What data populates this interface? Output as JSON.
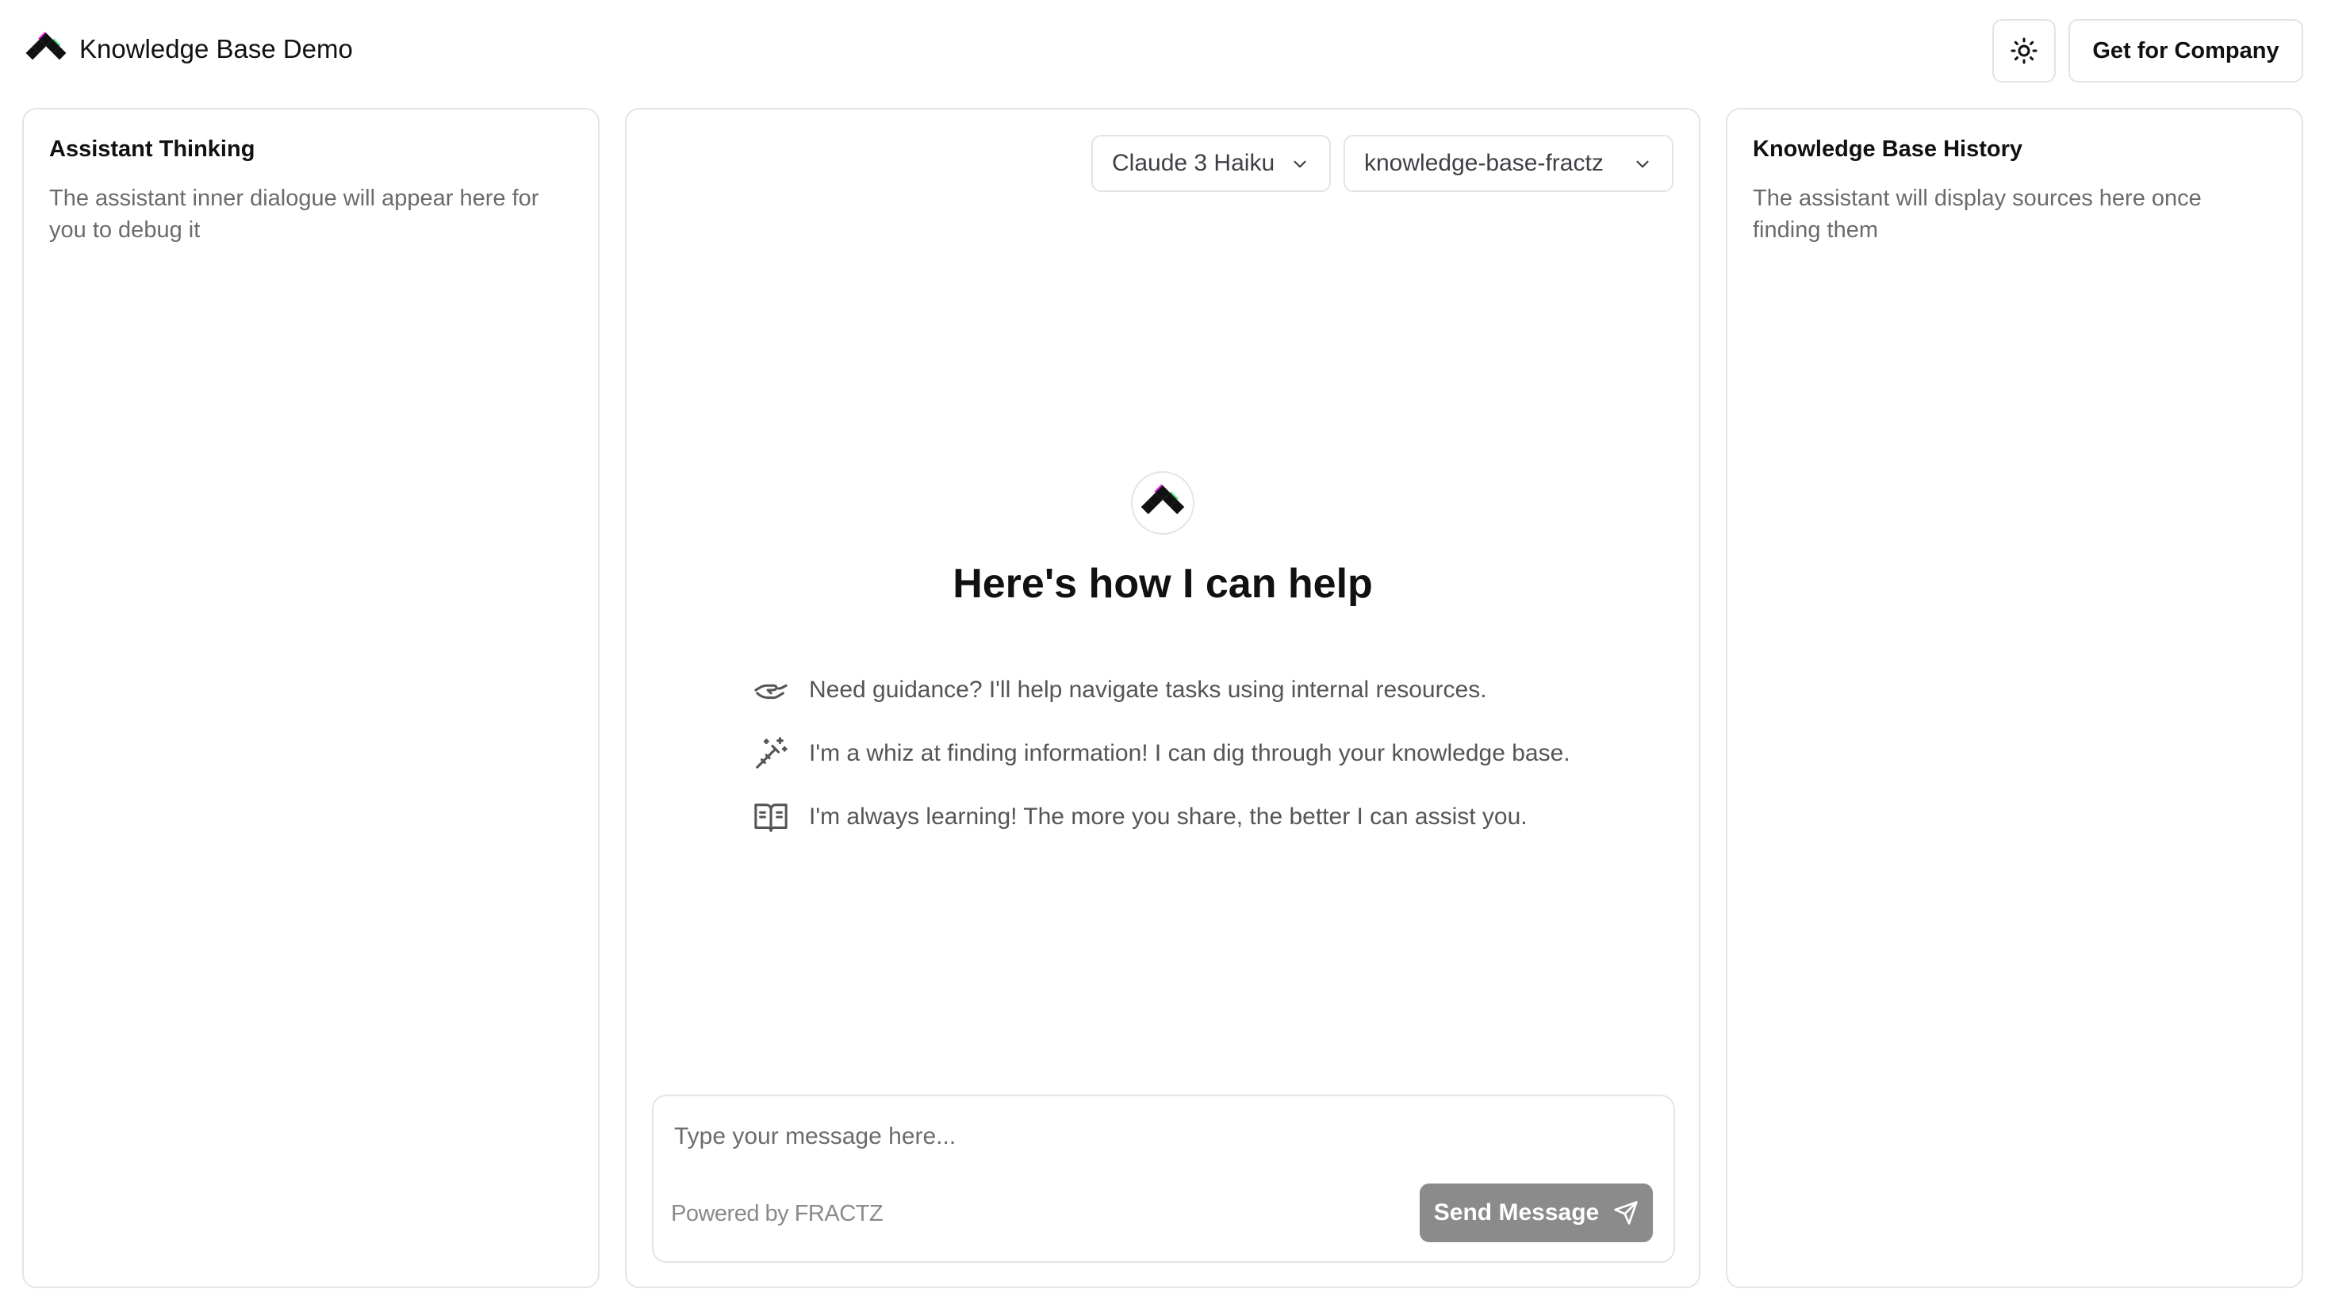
{
  "header": {
    "app_title": "Knowledge Base Demo",
    "logo_icon": "fractz-logo-icon",
    "theme_toggle_icon": "sun-icon",
    "company_button_label": "Get for Company"
  },
  "left_panel": {
    "title": "Assistant Thinking",
    "description": "The assistant inner dialogue will appear here for you to debug it"
  },
  "center_panel": {
    "model_select": {
      "selected": "Claude 3 Haiku",
      "icon": "chevron-down-icon"
    },
    "kb_select": {
      "selected": "knowledge-base-fractz",
      "icon": "chevron-down-icon"
    },
    "hero_title": "Here's how I can help",
    "features": [
      {
        "icon": "handshake-icon",
        "text": "Need guidance? I'll help navigate tasks using internal resources."
      },
      {
        "icon": "magic-wand-icon",
        "text": "I'm a whiz at finding information! I can dig through your knowledge base."
      },
      {
        "icon": "open-book-icon",
        "text": "I'm always learning! The more you share, the better I can assist you."
      }
    ],
    "composer": {
      "placeholder": "Type your message here...",
      "value": "",
      "powered_by": "Powered by FRACTZ",
      "send_label": "Send Message",
      "send_icon": "send-icon"
    }
  },
  "right_panel": {
    "title": "Knowledge Base History",
    "description": "The assistant will display sources here once finding them"
  },
  "colors": {
    "border": "#e4e4e7",
    "muted_text": "#6b6b6b",
    "send_button_bg": "#8b8b8b",
    "logo_green": "#4ade80",
    "logo_magenta": "#e11dde"
  }
}
